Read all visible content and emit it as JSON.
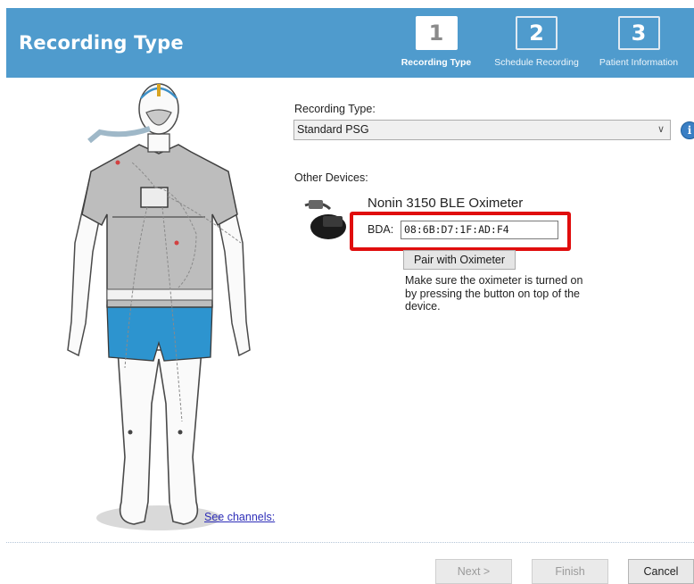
{
  "header": {
    "title": "Recording Type",
    "steps": [
      {
        "num": "1",
        "label": "Recording Type",
        "active": true
      },
      {
        "num": "2",
        "label": "Schedule Recording",
        "active": false
      },
      {
        "num": "3",
        "label": "Patient Information",
        "active": false
      }
    ]
  },
  "recording": {
    "label": "Recording Type:",
    "selected": "Standard PSG",
    "info_icon": "info-icon"
  },
  "devices": {
    "label": "Other Devices:",
    "device_name": "Nonin 3150 BLE Oximeter",
    "bda_label": "BDA:",
    "bda_value": "08:6B:D7:1F:AD:F4",
    "pair_button": "Pair with Oximeter",
    "note": "Make sure the oximeter is turned on by pressing the button on top of the device."
  },
  "diagram": {
    "link": "See channels:"
  },
  "footer": {
    "next": "Next >",
    "finish": "Finish",
    "cancel": "Cancel"
  },
  "colors": {
    "header_bg": "#4f9bcd",
    "highlight_box": "#e00d0d",
    "link": "#2d2db8"
  }
}
